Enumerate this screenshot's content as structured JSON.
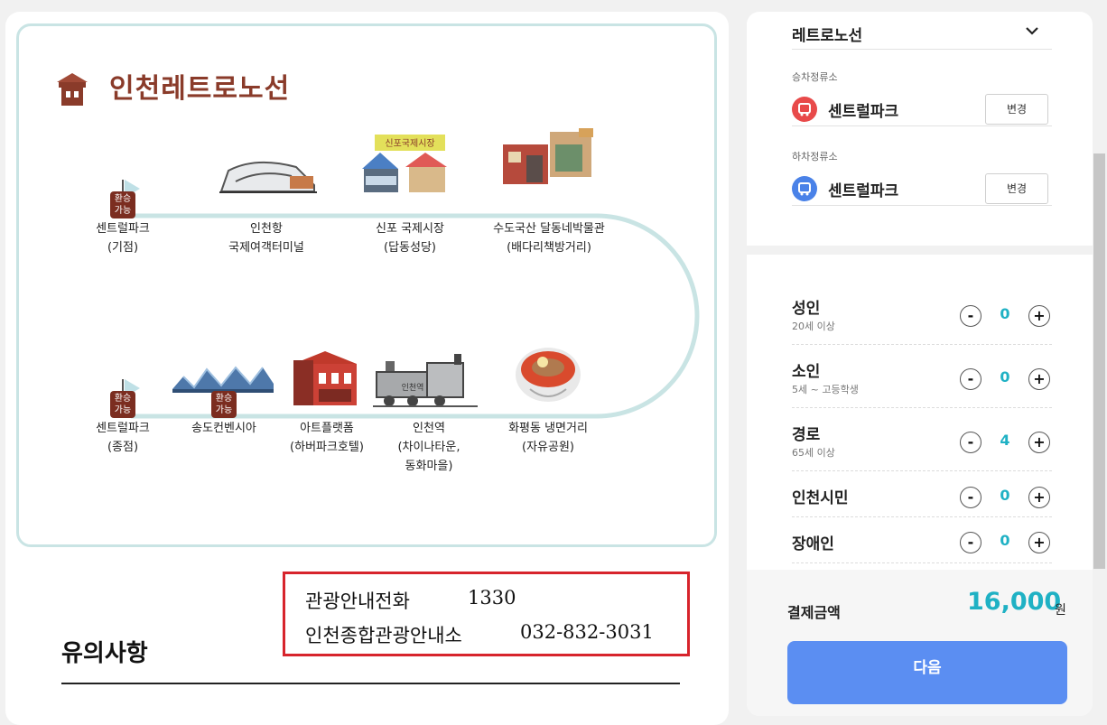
{
  "route_map": {
    "title": "인천레트로노선",
    "transfer_badge": "환승\n가능",
    "stops_top": [
      {
        "name": "센트럴파크",
        "sub": "(기점)"
      },
      {
        "name": "인천항",
        "sub": "국제여객터미널"
      },
      {
        "name": "신포 국제시장",
        "sub": "(답동성당)"
      },
      {
        "name": "수도국산 달동네박물관",
        "sub": "(배다리책방거리)"
      }
    ],
    "stops_bottom": [
      {
        "name": "센트럴파크",
        "sub": "(종점)"
      },
      {
        "name": "송도컨벤시아",
        "sub": ""
      },
      {
        "name": "아트플랫폼",
        "sub": "(하버파크호텔)"
      },
      {
        "name": "인천역",
        "sub": "(차이나타운,",
        "sub2": "동화마을)"
      },
      {
        "name": "화평동 냉면거리",
        "sub": "(자유공원)"
      }
    ],
    "market_sign": "신포국제시장",
    "train_sign": "인천역"
  },
  "notice": {
    "title": "유의사항"
  },
  "info_box": {
    "rows": [
      {
        "label": "관광안내전화",
        "value": "1330"
      },
      {
        "label": "인천종합관광안내소",
        "value": "032-832-3031"
      }
    ]
  },
  "panel": {
    "route_select": "레트로노선",
    "boarding_label": "승차정류소",
    "boarding_stop": "센트럴파크",
    "alighting_label": "하차정류소",
    "alighting_stop": "센트럴파크",
    "change_label": "변경",
    "passengers": [
      {
        "name": "성인",
        "sub": "20세 이상",
        "count": "0"
      },
      {
        "name": "소인",
        "sub": "5세 ~ 고등학생",
        "count": "0"
      },
      {
        "name": "경로",
        "sub": "65세 이상",
        "count": "4"
      },
      {
        "name": "인천시민",
        "sub": "",
        "count": "0"
      },
      {
        "name": "장애인",
        "sub": "",
        "count": "0"
      }
    ],
    "minus": "-",
    "plus": "+",
    "payment_label": "결제금액",
    "payment_amount": "16,000",
    "payment_unit": "원",
    "next_label": "다음"
  },
  "colors": {
    "accent": "#1fb1c4",
    "next": "#5b8ef2",
    "brand": "#7b2d20",
    "track": "#c9e4e4",
    "highlight": "#d7242c"
  }
}
